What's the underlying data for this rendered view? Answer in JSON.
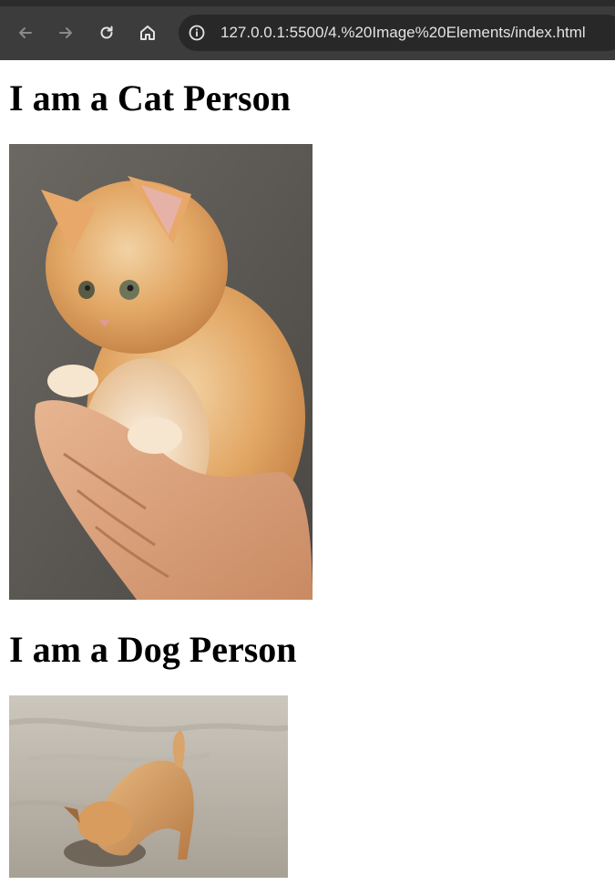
{
  "browser": {
    "url": "127.0.0.1:5500/4.%20Image%20Elements/index.html",
    "back_icon": "arrow-left-icon",
    "forward_icon": "arrow-right-icon",
    "reload_icon": "reload-icon",
    "home_icon": "home-icon",
    "site_info_icon": "info-icon"
  },
  "page": {
    "cat_heading": "I am a Cat Person",
    "dog_heading": "I am a Dog Person"
  },
  "colors": {
    "toolbar": "#3c3c3c",
    "omnibox": "#282828",
    "url_text": "#e3e3e3",
    "heading": "#000000"
  }
}
